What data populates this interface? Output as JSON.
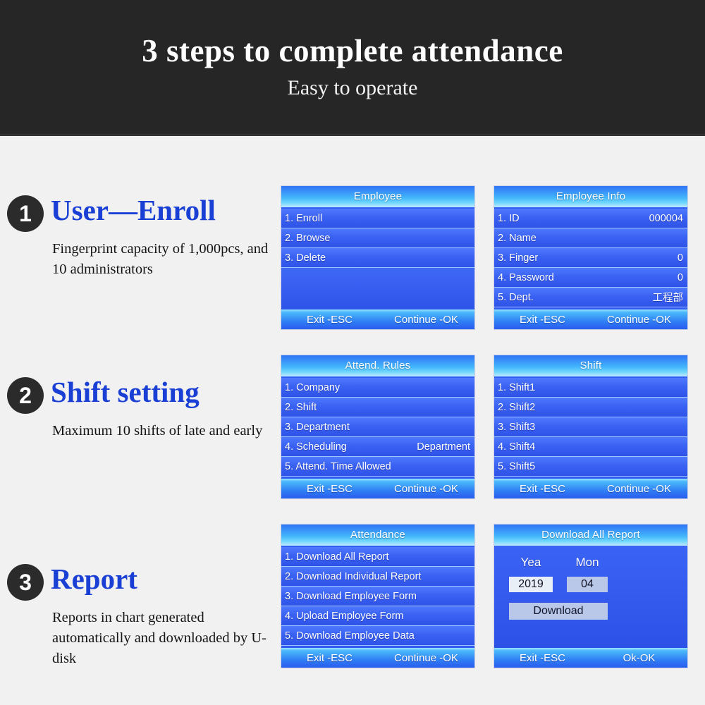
{
  "header": {
    "title": "3 steps to complete attendance",
    "subtitle": "Easy to operate",
    "background_color": "#262626",
    "text_color": "#ffffff"
  },
  "theme": {
    "page_background": "#f1f1f1",
    "accent_blue": "#1a3fd4",
    "screen_blue": "#3a62f5",
    "badge_dark": "#2b2b2b"
  },
  "steps": [
    {
      "number": "1",
      "heading": "User—Enroll",
      "body": "Fingerprint capacity of 1,000pcs, and 10 administrators"
    },
    {
      "number": "2",
      "heading": "Shift setting",
      "body": "Maximum 10 shifts of late and early"
    },
    {
      "number": "3",
      "heading": "Report",
      "body": "Reports in chart generated automatically and downloaded by U-disk"
    }
  ],
  "screens": {
    "employee": {
      "title": "Employee",
      "rows": [
        {
          "label": "1. Enroll",
          "value": ""
        },
        {
          "label": "2. Browse",
          "value": ""
        },
        {
          "label": "3. Delete",
          "value": ""
        }
      ],
      "footer_left": "Exit -ESC",
      "footer_right": "Continue -OK"
    },
    "employee_info": {
      "title": "Employee Info",
      "rows": [
        {
          "label": "1. ID",
          "value": "000004"
        },
        {
          "label": "2. Name",
          "value": ""
        },
        {
          "label": "3. Finger",
          "value": "0"
        },
        {
          "label": "4. Password",
          "value": "0"
        },
        {
          "label": "5. Dept.",
          "value": "工程部"
        }
      ],
      "footer_left": "Exit -ESC",
      "footer_right": "Continue -OK"
    },
    "attend_rules": {
      "title": "Attend. Rules",
      "rows": [
        {
          "label": "1. Company",
          "value": ""
        },
        {
          "label": "2. Shift",
          "value": ""
        },
        {
          "label": "3. Department",
          "value": ""
        },
        {
          "label": "4. Scheduling",
          "value": "Department"
        },
        {
          "label": "5. Attend. Time Allowed",
          "value": ""
        }
      ],
      "footer_left": "Exit -ESC",
      "footer_right": "Continue -OK"
    },
    "shift": {
      "title": "Shift",
      "rows": [
        {
          "label": "1. Shift1",
          "value": ""
        },
        {
          "label": "2. Shift2",
          "value": ""
        },
        {
          "label": "3. Shift3",
          "value": ""
        },
        {
          "label": "4. Shift4",
          "value": ""
        },
        {
          "label": "5. Shift5",
          "value": ""
        }
      ],
      "footer_left": "Exit -ESC",
      "footer_right": "Continue -OK"
    },
    "attendance": {
      "title": "Attendance",
      "rows": [
        {
          "label": "1. Download All Report",
          "value": ""
        },
        {
          "label": "2. Download Individual Report",
          "value": ""
        },
        {
          "label": "3. Download Employee Form",
          "value": ""
        },
        {
          "label": "4. Upload Employee Form",
          "value": ""
        },
        {
          "label": "5. Download Employee Data",
          "value": ""
        }
      ],
      "footer_left": "Exit -ESC",
      "footer_right": "Continue -OK"
    },
    "download_all_report": {
      "title": "Download All Report",
      "year_label": "Yea",
      "month_label": "Mon",
      "year_value": "2019",
      "month_value": "04",
      "download_button": "Download",
      "footer_left": "Exit -ESC",
      "footer_right": "Ok-OK"
    }
  }
}
